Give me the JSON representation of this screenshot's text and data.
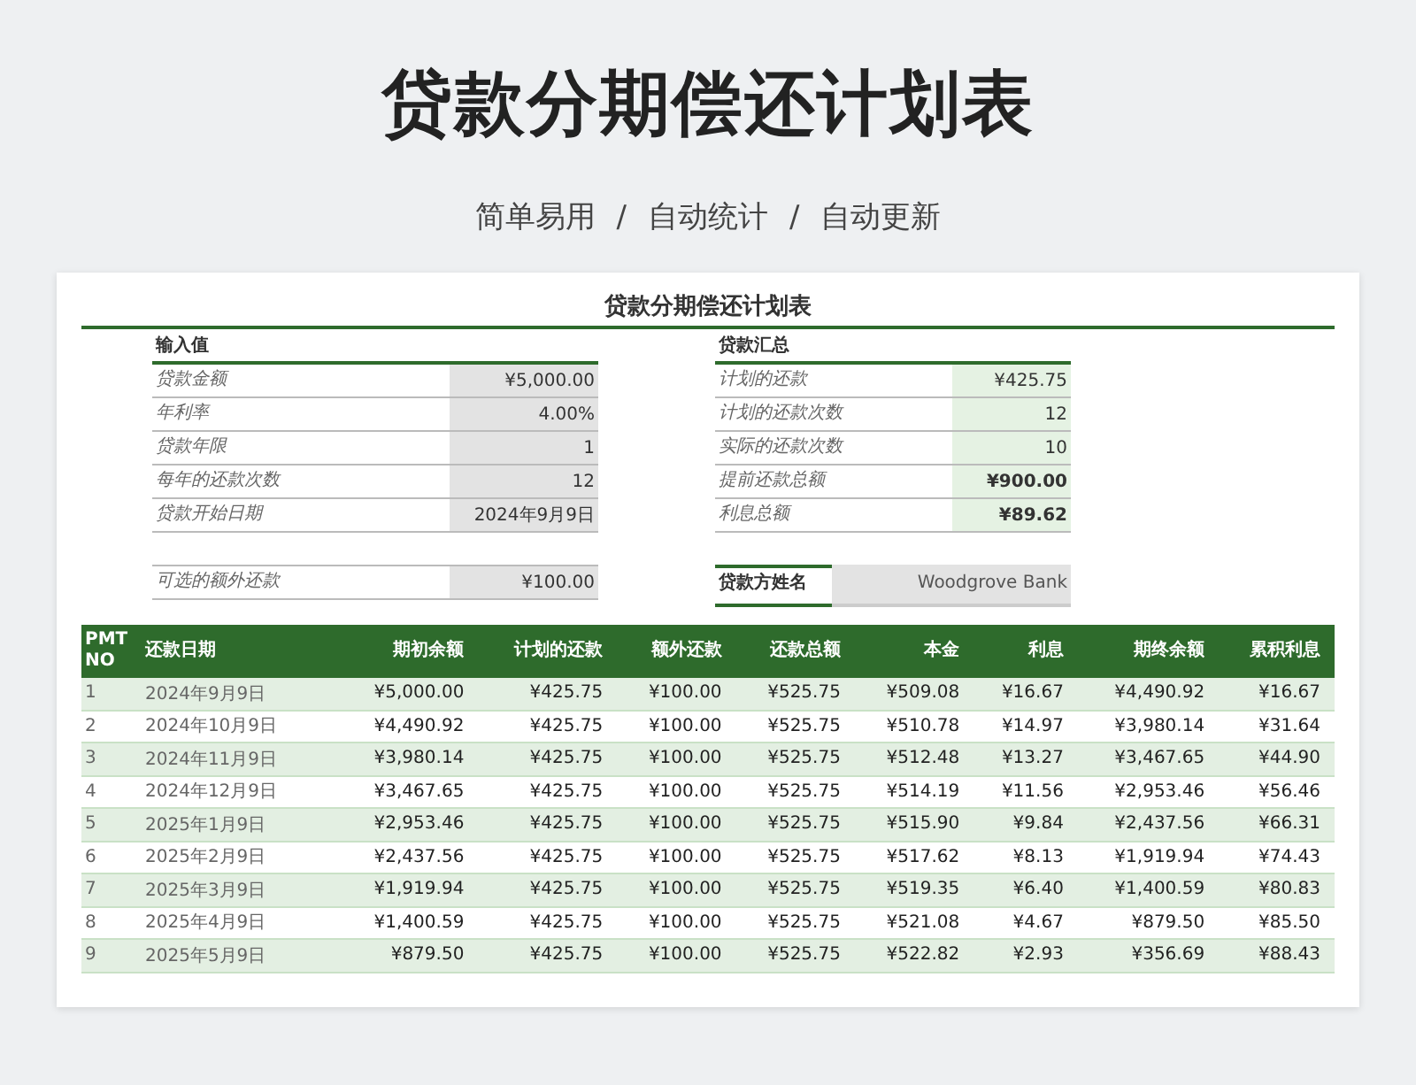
{
  "title": "贷款分期偿还计划表",
  "subtitle": [
    "简单易用",
    "/",
    "自动统计",
    "/",
    "自动更新"
  ],
  "sheet": {
    "title": "贷款分期偿还计划表",
    "inputs": {
      "heading": "输入值",
      "rows": [
        {
          "label": "贷款金额",
          "value": "¥5,000.00"
        },
        {
          "label": "年利率",
          "value": "4.00%"
        },
        {
          "label": "贷款年限",
          "value": "1"
        },
        {
          "label": "每年的还款次数",
          "value": "12"
        },
        {
          "label": "贷款开始日期",
          "value": "2024年9月9日"
        }
      ],
      "extra": {
        "label": "可选的额外还款",
        "value": "¥100.00"
      }
    },
    "summary": {
      "heading": "贷款汇总",
      "rows": [
        {
          "label": "计划的还款",
          "value": "¥425.75",
          "bold": false
        },
        {
          "label": "计划的还款次数",
          "value": "12",
          "bold": false
        },
        {
          "label": "实际的还款次数",
          "value": "10",
          "bold": false
        },
        {
          "label": "提前还款总额",
          "value": "¥900.00",
          "bold": true
        },
        {
          "label": "利息总额",
          "value": "¥89.62",
          "bold": true
        }
      ],
      "lender": {
        "label": "贷款方姓名",
        "value": "Woodgrove Bank"
      }
    },
    "table": {
      "columns": [
        "PMT NO",
        "还款日期",
        "期初余额",
        "计划的还款",
        "额外还款",
        "还款总额",
        "本金",
        "利息",
        "期终余额",
        "累积利息"
      ],
      "rows": [
        [
          "1",
          "2024年9月9日",
          "¥5,000.00",
          "¥425.75",
          "¥100.00",
          "¥525.75",
          "¥509.08",
          "¥16.67",
          "¥4,490.92",
          "¥16.67"
        ],
        [
          "2",
          "2024年10月9日",
          "¥4,490.92",
          "¥425.75",
          "¥100.00",
          "¥525.75",
          "¥510.78",
          "¥14.97",
          "¥3,980.14",
          "¥31.64"
        ],
        [
          "3",
          "2024年11月9日",
          "¥3,980.14",
          "¥425.75",
          "¥100.00",
          "¥525.75",
          "¥512.48",
          "¥13.27",
          "¥3,467.65",
          "¥44.90"
        ],
        [
          "4",
          "2024年12月9日",
          "¥3,467.65",
          "¥425.75",
          "¥100.00",
          "¥525.75",
          "¥514.19",
          "¥11.56",
          "¥2,953.46",
          "¥56.46"
        ],
        [
          "5",
          "2025年1月9日",
          "¥2,953.46",
          "¥425.75",
          "¥100.00",
          "¥525.75",
          "¥515.90",
          "¥9.84",
          "¥2,437.56",
          "¥66.31"
        ],
        [
          "6",
          "2025年2月9日",
          "¥2,437.56",
          "¥425.75",
          "¥100.00",
          "¥525.75",
          "¥517.62",
          "¥8.13",
          "¥1,919.94",
          "¥74.43"
        ],
        [
          "7",
          "2025年3月9日",
          "¥1,919.94",
          "¥425.75",
          "¥100.00",
          "¥525.75",
          "¥519.35",
          "¥6.40",
          "¥1,400.59",
          "¥80.83"
        ],
        [
          "8",
          "2025年4月9日",
          "¥1,400.59",
          "¥425.75",
          "¥100.00",
          "¥525.75",
          "¥521.08",
          "¥4.67",
          "¥879.50",
          "¥85.50"
        ],
        [
          "9",
          "2025年5月9日",
          "¥879.50",
          "¥425.75",
          "¥100.00",
          "¥525.75",
          "¥522.82",
          "¥2.93",
          "¥356.69",
          "¥88.43"
        ]
      ]
    }
  }
}
